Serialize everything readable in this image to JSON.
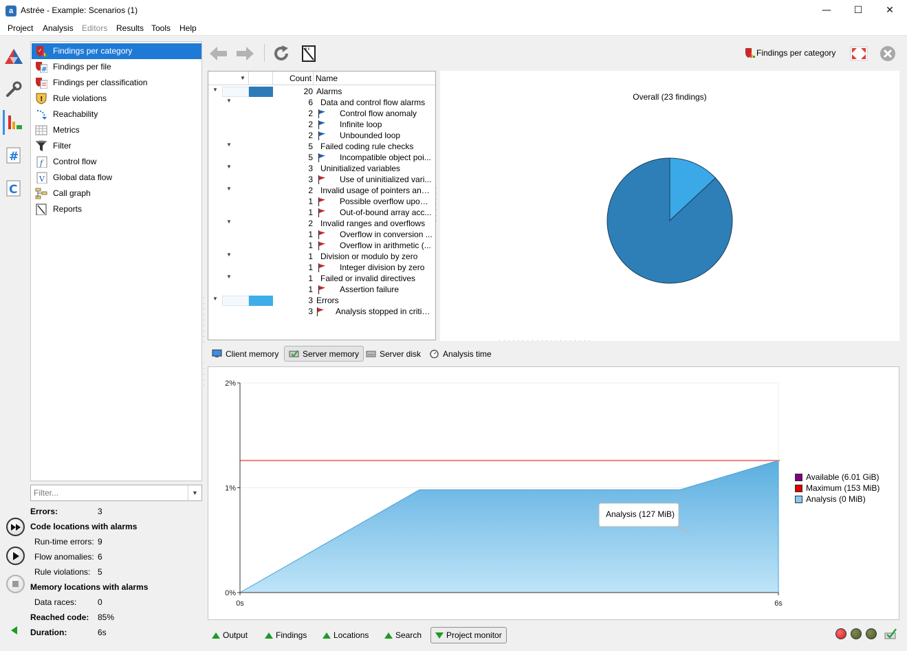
{
  "window": {
    "title": "Astrée - Example: Scenarios (1)",
    "app_icon_letter": "a",
    "minimize": "—",
    "maximize": "☐",
    "close": "✕"
  },
  "menu": [
    "Project",
    "Analysis",
    "Editors",
    "Results",
    "Tools",
    "Help"
  ],
  "menu_disabled": [
    "Editors"
  ],
  "views": [
    {
      "label": "Findings per category",
      "icon": "findings-category-icon",
      "selected": true
    },
    {
      "label": "Findings per file",
      "icon": "findings-file-icon"
    },
    {
      "label": "Findings per classification",
      "icon": "findings-classification-icon"
    },
    {
      "label": "Rule violations",
      "icon": "rule-violations-icon"
    },
    {
      "label": "Reachability",
      "icon": "reachability-icon"
    },
    {
      "label": "Metrics",
      "icon": "metrics-icon"
    },
    {
      "label": "Filter",
      "icon": "filter-icon"
    },
    {
      "label": "Control flow",
      "icon": "control-flow-icon"
    },
    {
      "label": "Global data flow",
      "icon": "global-data-flow-icon"
    },
    {
      "label": "Call graph",
      "icon": "call-graph-icon"
    },
    {
      "label": "Reports",
      "icon": "reports-icon"
    }
  ],
  "filter": {
    "placeholder": "Filter...",
    "value": ""
  },
  "summary": {
    "errors_label": "Errors:",
    "errors_value": "3",
    "code_locations_label": "Code locations with alarms",
    "runtime_errors_label": "Run-time errors:",
    "runtime_errors_value": "9",
    "flow_anomalies_label": "Flow anomalies:",
    "flow_anomalies_value": "6",
    "rule_violations_label": "Rule violations:",
    "rule_violations_value": "5",
    "memory_locations_label": "Memory locations with alarms",
    "data_races_label": "Data races:",
    "data_races_value": "0",
    "reached_code_label": "Reached code:",
    "reached_code_value": "85%",
    "duration_label": "Duration:",
    "duration_value": "6s"
  },
  "toolbar": {
    "current_view": "Findings per category"
  },
  "tree": {
    "headers": {
      "count": "Count",
      "name": "Name"
    },
    "rows": [
      {
        "level": 0,
        "count": "20",
        "name": "Alarms",
        "expanded": true,
        "bar": 1.0,
        "bar_color": "#2b7bb9"
      },
      {
        "level": 1,
        "count": "6",
        "name": "Data and control flow alarms",
        "expanded": true
      },
      {
        "level": 2,
        "count": "2",
        "name": "Control flow anomaly",
        "flag": "blue"
      },
      {
        "level": 2,
        "count": "2",
        "name": "Infinite loop",
        "flag": "blue"
      },
      {
        "level": 2,
        "count": "2",
        "name": "Unbounded loop",
        "flag": "blue"
      },
      {
        "level": 1,
        "count": "5",
        "name": "Failed coding rule checks",
        "expanded": true
      },
      {
        "level": 2,
        "count": "5",
        "name": "Incompatible object poi...",
        "flag": "blue"
      },
      {
        "level": 1,
        "count": "3",
        "name": "Uninitialized variables",
        "expanded": true
      },
      {
        "level": 2,
        "count": "3",
        "name": "Use of uninitialized vari...",
        "flag": "red"
      },
      {
        "level": 1,
        "count": "2",
        "name": "Invalid usage of pointers and ...",
        "expanded": true
      },
      {
        "level": 2,
        "count": "1",
        "name": "Possible overflow upon ...",
        "flag": "red"
      },
      {
        "level": 2,
        "count": "1",
        "name": "Out-of-bound array acc...",
        "flag": "red"
      },
      {
        "level": 1,
        "count": "2",
        "name": "Invalid ranges and overflows",
        "expanded": true
      },
      {
        "level": 2,
        "count": "1",
        "name": "Overflow in conversion ...",
        "flag": "red"
      },
      {
        "level": 2,
        "count": "1",
        "name": "Overflow in arithmetic (...",
        "flag": "red"
      },
      {
        "level": 1,
        "count": "1",
        "name": "Division or modulo by zero",
        "expanded": true
      },
      {
        "level": 2,
        "count": "1",
        "name": "Integer division by zero",
        "flag": "red"
      },
      {
        "level": 1,
        "count": "1",
        "name": "Failed or invalid directives",
        "expanded": true
      },
      {
        "level": 2,
        "count": "1",
        "name": "Assertion failure",
        "flag": "red"
      },
      {
        "level": 0,
        "count": "3",
        "name": "Errors",
        "expanded": true,
        "bar": 1.0,
        "bar_color": "#3daee9"
      },
      {
        "level": 1,
        "count": "3",
        "name": "Analysis stopped in critic...",
        "flag": "red"
      }
    ]
  },
  "pie_chart": {
    "title": "Overall (23 findings)",
    "slices": [
      {
        "label": "Alarms",
        "value": 20,
        "color": "#2e7fb8"
      },
      {
        "label": "Errors",
        "value": 3,
        "color": "#3ba8e8"
      }
    ]
  },
  "monitor_tabs": [
    {
      "label": "Client memory",
      "icon": "client-memory-icon"
    },
    {
      "label": "Server memory",
      "icon": "server-memory-icon",
      "active": true
    },
    {
      "label": "Server disk",
      "icon": "server-disk-icon"
    },
    {
      "label": "Analysis time",
      "icon": "analysis-time-icon"
    }
  ],
  "chart_data": {
    "type": "area",
    "x_ticks": [
      "0s",
      "6s"
    ],
    "y_ticks": [
      "0%",
      "1%",
      "2%"
    ],
    "xlim": [
      0,
      6
    ],
    "ylim": [
      0,
      2
    ],
    "series": [
      {
        "name": "Analysis (0 MiB)",
        "color": "#7fc4ea",
        "x": [
          0,
          2,
          4.9,
          6,
          6
        ],
        "y": [
          0,
          0.98,
          0.98,
          1.26,
          0
        ]
      }
    ],
    "maximum_line": {
      "name": "Maximum (153 MiB)",
      "y": 1.26,
      "color": "#f08080"
    },
    "legend": [
      {
        "label": "Available (6.01 GiB)",
        "color": "#800080"
      },
      {
        "label": "Maximum (153 MiB)",
        "color": "#e00000"
      },
      {
        "label": "Analysis (0 MiB)",
        "color": "#86c8ee"
      }
    ],
    "legend_position": "right",
    "tooltip": "Analysis (127 MiB)",
    "grid": true
  },
  "bottom_tabs": [
    {
      "label": "Output"
    },
    {
      "label": "Findings"
    },
    {
      "label": "Locations"
    },
    {
      "label": "Search"
    },
    {
      "label": "Project monitor",
      "active": true
    }
  ],
  "status_dots": [
    "#c81e1e",
    "#4a5a2a",
    "#4a5a2a"
  ]
}
